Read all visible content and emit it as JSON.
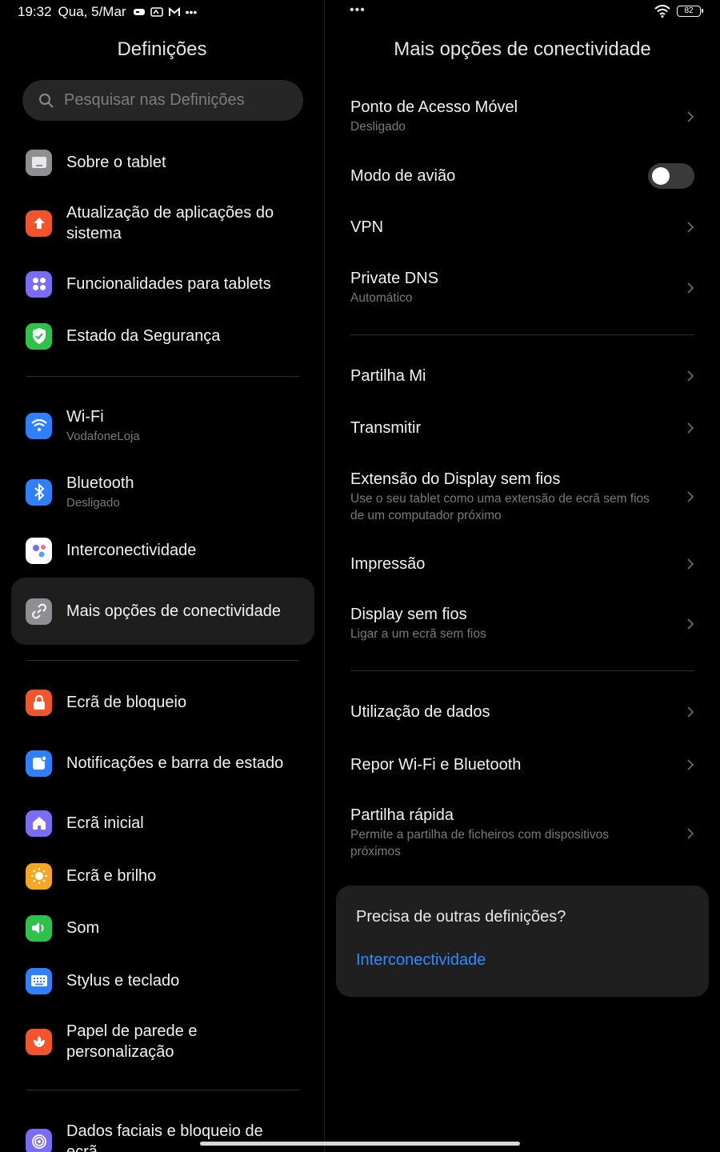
{
  "status_bar": {
    "time": "19:32",
    "date": "Qua, 5/Mar",
    "dots": "•••",
    "battery": "82"
  },
  "left": {
    "title": "Definições",
    "search_placeholder": "Pesquisar nas Definições",
    "items": [
      {
        "label": "Sobre o tablet",
        "sub": "",
        "icon": "tablet-icon",
        "color": "#8e8e93"
      },
      {
        "label": "Atualização de aplicações do sistema",
        "sub": "",
        "icon": "arrow-up-icon",
        "color": "#f2552c"
      },
      {
        "label": "Funcionalidades para tablets",
        "sub": "",
        "icon": "apps-grid-icon",
        "color": "#7b6cf6"
      },
      {
        "label": "Estado da Segurança",
        "sub": "",
        "icon": "shield-check-icon",
        "color": "#2ec24b"
      },
      {
        "label": "Wi-Fi",
        "sub": "VodafoneLoja",
        "icon": "wifi-icon",
        "color": "#2f80ff"
      },
      {
        "label": "Bluetooth",
        "sub": "Desligado",
        "icon": "bluetooth-icon",
        "color": "#2f80ff"
      },
      {
        "label": "Interconectividade",
        "sub": "",
        "icon": "interconnect-icon",
        "color": "#ffffff"
      },
      {
        "label": "Mais opções de conectividade",
        "sub": "",
        "icon": "link-icon",
        "color": "#8e8e93"
      },
      {
        "label": "Ecrã de bloqueio",
        "sub": "",
        "icon": "lock-icon",
        "color": "#f2552c"
      },
      {
        "label": "Notificações e barra de estado",
        "sub": "",
        "icon": "notification-icon",
        "color": "#2f80ff"
      },
      {
        "label": "Ecrã inicial",
        "sub": "",
        "icon": "home-icon",
        "color": "#7b6cf6"
      },
      {
        "label": "Ecrã e brilho",
        "sub": "",
        "icon": "sun-icon",
        "color": "#f5a623"
      },
      {
        "label": "Som",
        "sub": "",
        "icon": "speaker-icon",
        "color": "#2ec24b"
      },
      {
        "label": "Stylus e teclado",
        "sub": "",
        "icon": "keyboard-icon",
        "color": "#2f80ff"
      },
      {
        "label": "Papel de parede e personalização",
        "sub": "",
        "icon": "wallpaper-icon",
        "color": "#f2552c"
      },
      {
        "label": "Dados faciais e bloqueio de ecrã",
        "sub": "",
        "icon": "fingerprint-icon",
        "color": "#7b6cf6"
      }
    ]
  },
  "right": {
    "title": "Mais opções de conectividade",
    "rows": [
      {
        "title": "Ponto de Acesso Móvel",
        "sub": "Desligado"
      },
      {
        "title": "Modo de avião",
        "sub": "",
        "toggle_on": false
      },
      {
        "title": "VPN",
        "sub": ""
      },
      {
        "title": "Private DNS",
        "sub": "Automático"
      },
      {
        "title": "Partilha Mi",
        "sub": ""
      },
      {
        "title": "Transmitir",
        "sub": ""
      },
      {
        "title": "Extensão do Display sem fios",
        "sub": "Use o seu tablet como uma extensão de ecrã sem fios de um computador próximo"
      },
      {
        "title": "Impressão",
        "sub": ""
      },
      {
        "title": "Display sem fios",
        "sub": "Ligar a um ecrã sem fios"
      },
      {
        "title": "Utilização de dados",
        "sub": ""
      },
      {
        "title": "Repor Wi-Fi e Bluetooth",
        "sub": ""
      },
      {
        "title": "Partilha rápida",
        "sub": "Permite a partilha de ficheiros com dispositivos próximos"
      }
    ],
    "help_card": {
      "question": "Precisa de outras definições?",
      "link": "Interconectividade"
    }
  },
  "colors": {
    "accent": "#2f8cff",
    "background": "#000000",
    "card": "#1f1f1f"
  }
}
